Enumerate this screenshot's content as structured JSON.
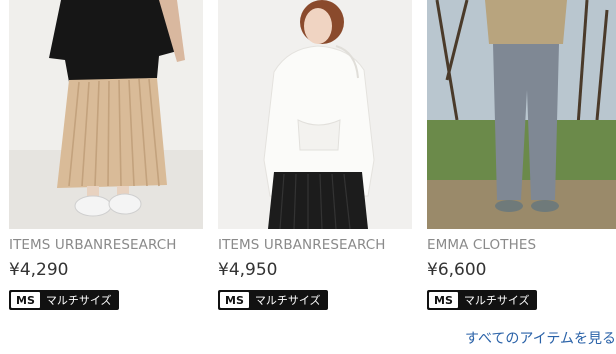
{
  "products": [
    {
      "brand": "ITEMS URBANRESEARCH",
      "price": "¥4,290",
      "badge_code": "MS",
      "badge_label": "マルチサイズ"
    },
    {
      "brand": "ITEMS URBANRESEARCH",
      "price": "¥4,950",
      "badge_code": "MS",
      "badge_label": "マルチサイズ"
    },
    {
      "brand": "EMMA CLOTHES",
      "price": "¥6,600",
      "badge_code": "MS",
      "badge_label": "マルチサイズ"
    }
  ],
  "see_all_link": "すべてのアイテムを見る",
  "colors": {
    "link": "#2a62a8",
    "brand_text": "#8a8a8a",
    "badge_bg": "#111111"
  }
}
